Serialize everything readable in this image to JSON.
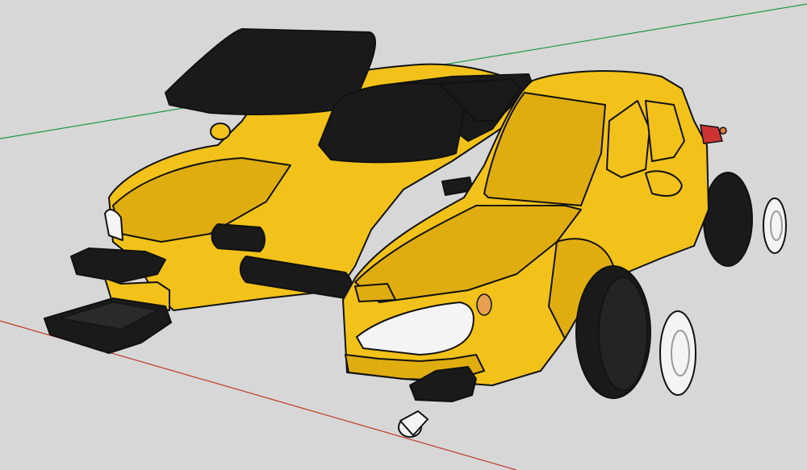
{
  "viewport": {
    "background": "#d7d7d7",
    "axis_colors": {
      "green": "#1f9a3a",
      "red": "#c0392b"
    }
  },
  "model": {
    "body_color": "#f2c21a",
    "shade_color": "#e0ad10",
    "trim_color": "#1a1a1a",
    "rim_color": "#f4f4f4",
    "outline_color": "#111111"
  }
}
